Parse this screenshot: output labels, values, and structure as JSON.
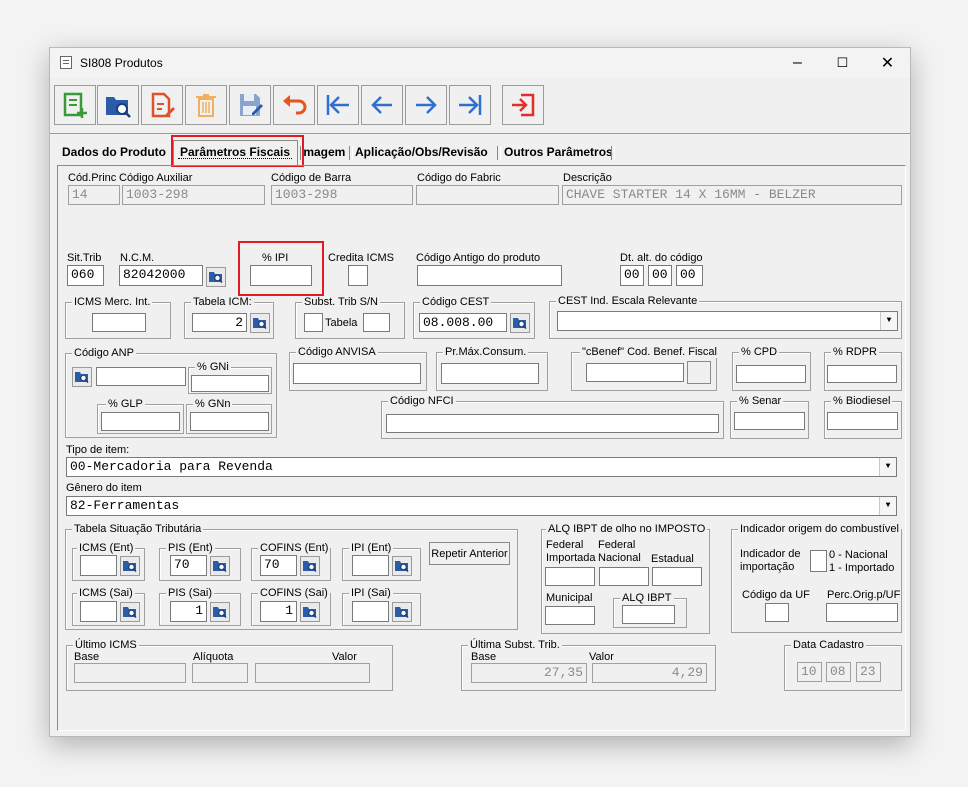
{
  "window": {
    "title": "SI808 Produtos",
    "minimize": "–",
    "maximize": "☐",
    "close": "✕"
  },
  "toolbar": {
    "icons": [
      "add-record-icon",
      "search-record-icon",
      "edit-record-icon",
      "delete-record-icon",
      "save-record-icon",
      "undo-icon",
      "first-record-icon",
      "previous-record-icon",
      "next-record-icon",
      "last-record-icon",
      "exit-icon"
    ]
  },
  "tabs": [
    "Dados do  Produto",
    "Parâmetros Fiscais",
    "Imagem",
    "Aplicação/Obs/Revisão",
    "Outros Parâmetros"
  ],
  "header": {
    "cod_princ_label": "Cód.Princ",
    "cod_princ": "14",
    "cod_aux_label": "Código Auxiliar",
    "cod_aux": "1003-298",
    "cod_barra_label": "Código de Barra",
    "cod_barra": "1003-298",
    "cod_fabric_label": "Código do Fabric",
    "cod_fabric": "",
    "descricao_label": "Descrição",
    "descricao": "CHAVE STARTER 14 X 16MM - BELZER"
  },
  "row2": {
    "sit_trib_label": "Sit.Trib",
    "sit_trib": "060",
    "ncm_label": "N.C.M.",
    "ncm": "82042000",
    "ipi_label": "% IPI",
    "ipi": "",
    "credita_icms_label": "Credita ICMS",
    "cod_antigo_label": "Código Antigo do produto",
    "cod_antigo": "",
    "dt_alt_label": "Dt. alt. do código",
    "dt_alt": [
      "00",
      "00",
      "00"
    ]
  },
  "row3": {
    "icms_merc_label": "ICMS Merc. Int.",
    "tabela_icm_label": "Tabela ICM:",
    "tabela_icm": "2",
    "subst_label": "Subst. Trib S/N",
    "tabela_label": "Tabela",
    "cest_label": "Código CEST",
    "cest": "08.008.00",
    "cest_escala_label": "CEST Ind. Escala Relevante"
  },
  "row4": {
    "anp_label": "Código ANP",
    "gni_label": "% GNi",
    "glp_label": "% GLP",
    "gnn_label": "% GNn",
    "anvisa_label": "Código ANVISA",
    "pr_max_label": "Pr.Máx.Consum.",
    "cbenef_label": "\"cBenef\" Cod. Benef. Fiscal",
    "cpd_label": "% CPD",
    "rdpr_label": "% RDPR",
    "nfci_label": "Código NFCI",
    "senar_label": "% Senar",
    "biodiesel_label": "% Biodiesel"
  },
  "tipo_item": {
    "label": "Tipo de item:",
    "value": "00-Mercadoria para Revenda"
  },
  "genero_item": {
    "label": "Gênero do item",
    "value": "82-Ferramentas"
  },
  "tst": {
    "label": "Tabela Situação Tributária",
    "icms_ent": "ICMS (Ent)",
    "pis_ent": "PIS (Ent)",
    "pis_ent_v": "70",
    "cofins_ent": "COFINS (Ent)",
    "cofins_ent_v": "70",
    "ipi_ent": "IPI (Ent)",
    "repetir": "Repetir Anterior",
    "icms_sai": "ICMS (Sai)",
    "pis_sai": "PIS (Sai)",
    "pis_sai_v": "1",
    "cofins_sai": "COFINS (Sai)",
    "cofins_sai_v": "1",
    "ipi_sai": "IPI (Sai)"
  },
  "ibpt": {
    "label": "ALQ IBPT de olho no IMPOSTO",
    "fed_imp": [
      "Federal",
      "Importada"
    ],
    "fed_nac": [
      "Federal",
      "Nacional"
    ],
    "estadual": "Estadual",
    "municipal": "Municipal",
    "alq_ibpt": "ALQ IBPT"
  },
  "combustivel": {
    "label": "Indicador origem do combustível",
    "ind_imp": [
      "Indicador de",
      "importação"
    ],
    "opt": [
      "0 - Nacional",
      "1 - Importado"
    ],
    "cod_uf": "Código da UF",
    "perc": "Perc.Orig.p/UF"
  },
  "ultimo_icms": {
    "label": "Último ICMS",
    "base": "Base",
    "aliquota": "Alíquota",
    "valor": "Valor"
  },
  "ultima_subst": {
    "label": "Última Subst. Trib.",
    "base": "Base",
    "valor": "Valor",
    "base_v": "27,35",
    "valor_v": "4,29"
  },
  "data_cadastro": {
    "label": "Data Cadastro",
    "parts": [
      "10",
      "08",
      "23"
    ]
  },
  "colors": {
    "highlight": "#e01b24",
    "window_bg": "#f0f0f0"
  }
}
